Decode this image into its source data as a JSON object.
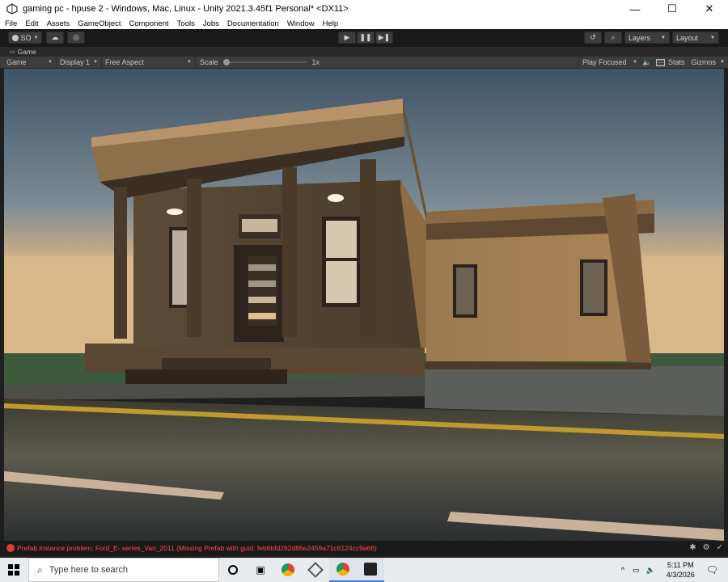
{
  "window": {
    "title": "gaming pc - hpuse 2 - Windows, Mac, Linux - Unity 2021.3.45f1 Personal* <DX11>",
    "minimize": "—",
    "maximize": "☐",
    "close": "✕"
  },
  "menu": [
    "File",
    "Edit",
    "Assets",
    "GameObject",
    "Component",
    "Tools",
    "Jobs",
    "Documentation",
    "Window",
    "Help"
  ],
  "toolbar": {
    "account": "SO",
    "layers": "Layers",
    "layout": "Layout"
  },
  "tab": {
    "label": "Game"
  },
  "gamebar": {
    "mode": "Game",
    "display": "Display 1",
    "aspect": "Free Aspect",
    "scale_label": "Scale",
    "scale_value": "1x",
    "play_focused": "Play Focused",
    "stats": "Stats",
    "gizmos": "Gizmos"
  },
  "status": {
    "message": "Prefab instance problem: Ford_E- series_Van_2011 (Missing Prefab with guid: feb6bfd262d86e2459a71c6124cc9a66)"
  },
  "taskbar": {
    "search_placeholder": "Type here to search",
    "time": "5:11 PM",
    "date": "4/3/2026"
  },
  "colors": {
    "unity_dark": "#191919",
    "panel": "#3c3c3c",
    "error": "#ff4c4c",
    "sky_top": "#4a5f73",
    "sky_horizon": "#d9b98a",
    "wall": "#a07a50"
  }
}
